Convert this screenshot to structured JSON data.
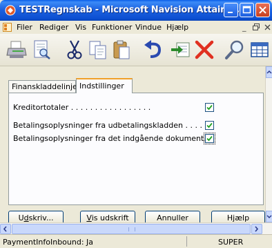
{
  "window": {
    "title": "TESTRegnskab - Microsoft Navision Attain - ...",
    "controls": [
      "minimize",
      "maximize",
      "close"
    ]
  },
  "menu": {
    "items": [
      "Filer",
      "Rediger",
      "Vis",
      "Funktioner",
      "Vindue",
      "Hjælp"
    ],
    "mdi_controls": [
      "_",
      "̅̅"
    ]
  },
  "toolbar": {
    "icons": [
      "print-icon",
      "preview-icon",
      "cut-icon",
      "copy-icon",
      "paste-icon",
      "undo-icon",
      "insert-icon",
      "delete-icon",
      "find-icon",
      "table-icon"
    ]
  },
  "form": {
    "tabs": [
      {
        "label": "Finanskladdelinje",
        "active": false
      },
      {
        "label": "Indstillinger",
        "active": true
      }
    ],
    "fields": [
      {
        "label": "Kreditortotaler . . . . . . . . . . . . . . . . .",
        "checked": true
      },
      {
        "label": "Betalingsoplysninger fra udbetalingskladden . . . .",
        "checked": true
      },
      {
        "label": "Betalingsoplysninger fra det indgående dokument. .",
        "checked": true
      }
    ],
    "buttons": {
      "print": "Udskriv...",
      "preview": "Vis udskrift",
      "cancel": "Annuller",
      "help": "Hjælp"
    }
  },
  "statusbar": {
    "text": "PaymentInfoInbound: Ja",
    "user": "SUPER"
  },
  "colors": {
    "titlebar": "#0c4fd1",
    "tab_highlight": "#f0a028",
    "checkmark": "#21a121",
    "delete_x": "#e03020"
  }
}
